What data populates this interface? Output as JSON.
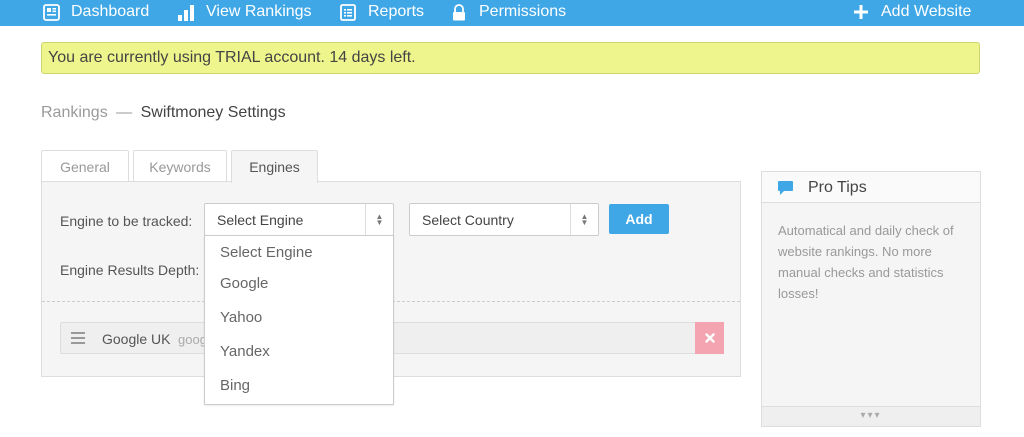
{
  "nav": {
    "dashboard": "Dashboard",
    "view_rankings": "View Rankings",
    "reports": "Reports",
    "permissions": "Permissions",
    "add_website": "Add Website",
    "bg_color": "#3fa7e6"
  },
  "trial_banner": "You are currently using TRIAL account. 14 days left.",
  "breadcrumb": {
    "parent": "Rankings",
    "separator": "—",
    "current": "Swiftmoney Settings"
  },
  "tabs": [
    {
      "label": "General",
      "active": false
    },
    {
      "label": "Keywords",
      "active": false
    },
    {
      "label": "Engines",
      "active": true
    }
  ],
  "form": {
    "engine_label": "Engine to be tracked:",
    "engine_select_value": "Select Engine",
    "country_select_value": "Select Country",
    "add_button": "Add",
    "depth_label": "Engine Results Depth:"
  },
  "engine_dropdown": {
    "options": [
      "Select Engine",
      "Google",
      "Yahoo",
      "Yandex",
      "Bing"
    ]
  },
  "engine_list": [
    {
      "name": "Google UK",
      "domain": "goog"
    }
  ],
  "pro_tips": {
    "title": "Pro Tips",
    "body": "Automatical and daily check of website rankings. No more manual checks and statistics losses!",
    "footer": "▾▾▾"
  },
  "colors": {
    "accent": "#3fa7e6",
    "trial_bg": "#eef58c",
    "delete": "#f4a3b0"
  },
  "icons": [
    "dashboard-icon",
    "bar-chart-icon",
    "reports-icon",
    "lock-icon",
    "plus-icon",
    "chat-icon",
    "drag-handle-icon",
    "close-icon"
  ]
}
